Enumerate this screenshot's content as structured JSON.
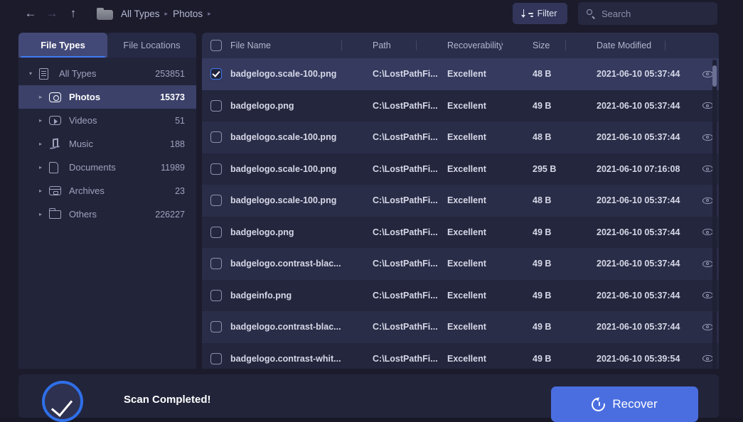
{
  "topbar": {
    "back_icon": "arrow-left-icon",
    "forward_icon": "arrow-right-icon",
    "up_icon": "arrow-up-icon",
    "folder_icon": "folder-icon",
    "breadcrumbs": [
      "All Types",
      "Photos"
    ],
    "separator": "▸",
    "filter_label": "Filter",
    "search_placeholder": "Search"
  },
  "sidebar": {
    "tabs": [
      {
        "label": "File Types",
        "active": true
      },
      {
        "label": "File Locations",
        "active": false
      }
    ],
    "items": [
      {
        "label": "All Types",
        "count": "253851",
        "icon": "document-icon",
        "caret": "▾",
        "level": 0,
        "selected": false
      },
      {
        "label": "Photos",
        "count": "15373",
        "icon": "camera-icon",
        "caret": "▸",
        "level": 1,
        "selected": true
      },
      {
        "label": "Videos",
        "count": "51",
        "icon": "video-icon",
        "caret": "▸",
        "level": 1,
        "selected": false
      },
      {
        "label": "Music",
        "count": "188",
        "icon": "music-icon",
        "caret": "▸",
        "level": 1,
        "selected": false
      },
      {
        "label": "Documents",
        "count": "11989",
        "icon": "file-icon",
        "caret": "▸",
        "level": 1,
        "selected": false
      },
      {
        "label": "Archives",
        "count": "23",
        "icon": "archive-icon",
        "caret": "▸",
        "level": 1,
        "selected": false
      },
      {
        "label": "Others",
        "count": "226227",
        "icon": "folder-icon",
        "caret": "▸",
        "level": 1,
        "selected": false
      }
    ]
  },
  "table": {
    "columns": [
      "File Name",
      "Path",
      "Recoverability",
      "Size",
      "Date Modified"
    ],
    "header_checkbox_checked": false,
    "preview_icon": "eye-icon",
    "rows": [
      {
        "name": "badgelogo.scale-100.png",
        "path": "C:\\LostPathFi...",
        "recoverability": "Excellent",
        "size": "48 B",
        "date": "2021-06-10 05:37:44",
        "checked": true
      },
      {
        "name": "badgelogo.png",
        "path": "C:\\LostPathFi...",
        "recoverability": "Excellent",
        "size": "49 B",
        "date": "2021-06-10 05:37:44",
        "checked": false
      },
      {
        "name": "badgelogo.scale-100.png",
        "path": "C:\\LostPathFi...",
        "recoverability": "Excellent",
        "size": "48 B",
        "date": "2021-06-10 05:37:44",
        "checked": false
      },
      {
        "name": "badgelogo.scale-100.png",
        "path": "C:\\LostPathFi...",
        "recoverability": "Excellent",
        "size": "295 B",
        "date": "2021-06-10 07:16:08",
        "checked": false
      },
      {
        "name": "badgelogo.scale-100.png",
        "path": "C:\\LostPathFi...",
        "recoverability": "Excellent",
        "size": "48 B",
        "date": "2021-06-10 05:37:44",
        "checked": false
      },
      {
        "name": "badgelogo.png",
        "path": "C:\\LostPathFi...",
        "recoverability": "Excellent",
        "size": "49 B",
        "date": "2021-06-10 05:37:44",
        "checked": false
      },
      {
        "name": "badgelogo.contrast-blac...",
        "path": "C:\\LostPathFi...",
        "recoverability": "Excellent",
        "size": "49 B",
        "date": "2021-06-10 05:37:44",
        "checked": false
      },
      {
        "name": "badgeinfo.png",
        "path": "C:\\LostPathFi...",
        "recoverability": "Excellent",
        "size": "49 B",
        "date": "2021-06-10 05:37:44",
        "checked": false
      },
      {
        "name": "badgelogo.contrast-blac...",
        "path": "C:\\LostPathFi...",
        "recoverability": "Excellent",
        "size": "49 B",
        "date": "2021-06-10 05:37:44",
        "checked": false
      },
      {
        "name": "badgelogo.contrast-whit...",
        "path": "C:\\LostPathFi...",
        "recoverability": "Excellent",
        "size": "49 B",
        "date": "2021-06-10 05:39:54",
        "checked": false
      }
    ]
  },
  "footer": {
    "status_icon": "check-circle-icon",
    "title": "Scan Completed!",
    "recover_label": "Recover",
    "recover_icon": "restore-clock-icon"
  },
  "colors": {
    "accent": "#3e7bf0",
    "recover_button": "#4a6ee0",
    "panel": "#22243a",
    "app_background": "#1b1b2c",
    "row_odd": "#2a2d47",
    "row_even": "#23263c",
    "row_selected": "#353a5e"
  }
}
